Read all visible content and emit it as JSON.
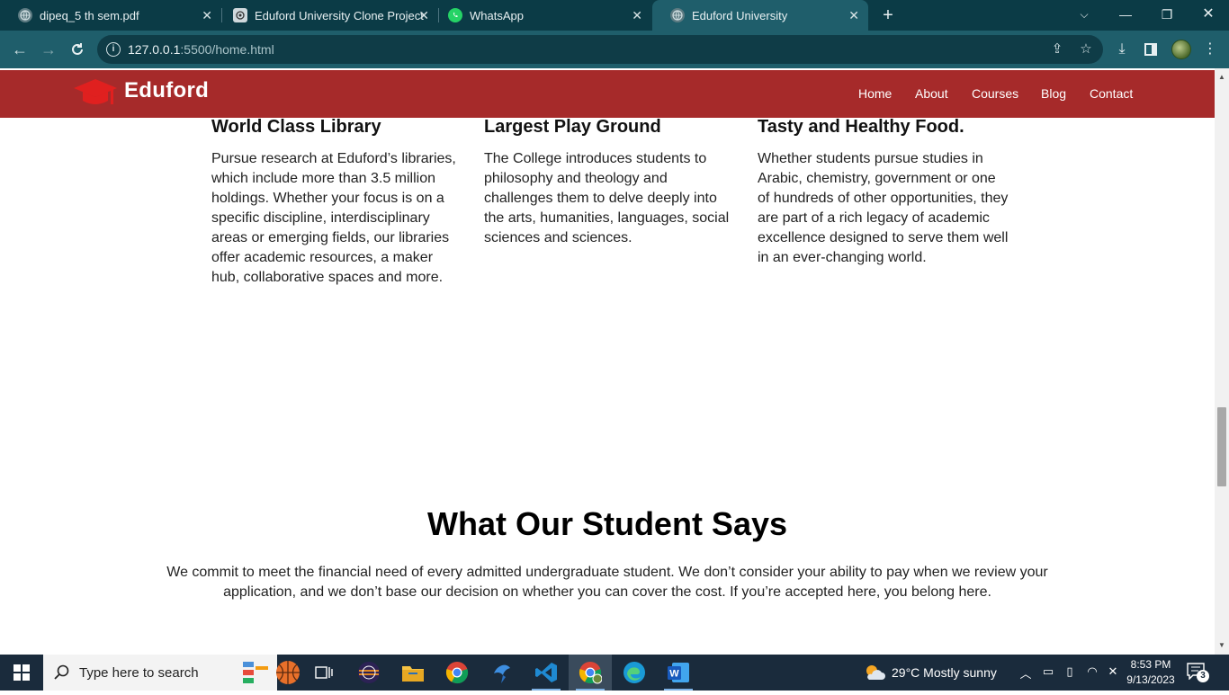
{
  "browser": {
    "tabs": [
      {
        "title": "dipeq_5 th sem.pdf",
        "active": false
      },
      {
        "title": "Eduford University Clone Project",
        "active": false
      },
      {
        "title": "WhatsApp",
        "active": false
      },
      {
        "title": "Eduford University",
        "active": true
      }
    ],
    "url_host": "127.0.0.1",
    "url_path": ":5500/home.html"
  },
  "site": {
    "brand": "Eduford",
    "nav": [
      "Home",
      "About",
      "Courses",
      "Blog",
      "Contact"
    ],
    "features": [
      {
        "title": "World Class Library",
        "text": "Pursue research at Eduford’s libraries, which include more than 3.5 million holdings. Whether your focus is on a specific discipline, interdisciplinary areas or emerging fields, our libraries offer academic resources, a maker hub, collaborative spaces and more."
      },
      {
        "title": "Largest Play Ground",
        "text": "The College introduces students to philosophy and theology and challenges them to delve deeply into the arts, humanities, languages, social sciences and sciences."
      },
      {
        "title": "Tasty and Healthy Food.",
        "text": "Whether students pursue studies in Arabic, chemistry, government or one of hundreds of other opportunities, they are part of a rich legacy of academic excellence designed to serve them well in an ever-changing world."
      }
    ],
    "testimonials": {
      "heading": "What Our Student Says",
      "text": "We commit to meet the financial need of every admitted undergraduate student. We don’t consider your ability to pay when we review your application, and we don’t base our decision on whether you can cover the cost. If you’re accepted here, you belong here."
    },
    "colors": {
      "nav_bg": "#a62a2a",
      "logo_red": "#e0201f"
    }
  },
  "taskbar": {
    "search_placeholder": "Type here to search",
    "weather": "29°C  Mostly sunny",
    "time": "8:53 PM",
    "date": "9/13/2023",
    "notification_count": "3"
  }
}
